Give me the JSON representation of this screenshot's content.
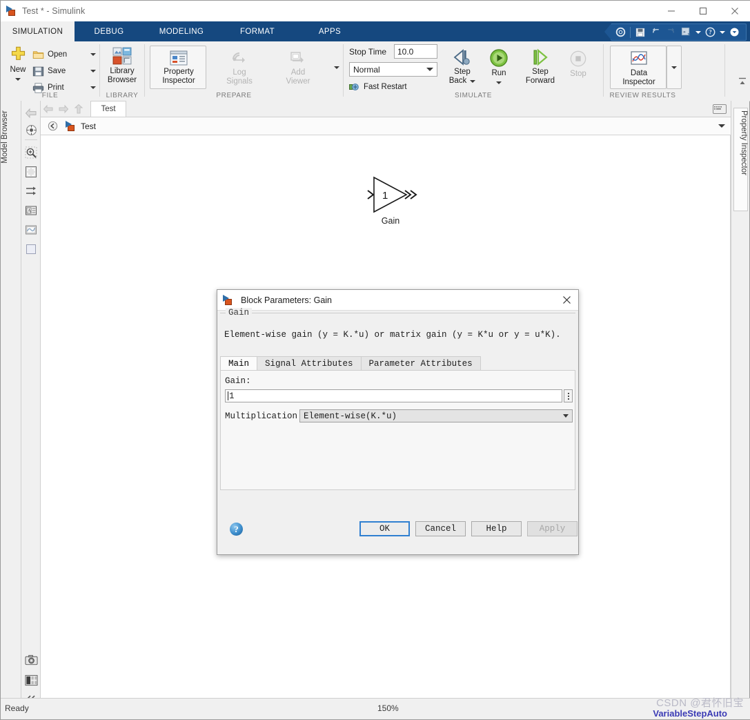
{
  "window": {
    "title": "Test * - Simulink",
    "app_icon": "simulink-icon",
    "minimize": "minimize-icon",
    "maximize": "maximize-icon",
    "close": "close-icon"
  },
  "ribbon_tabs": [
    {
      "label": "SIMULATION",
      "active": true
    },
    {
      "label": "DEBUG",
      "active": false
    },
    {
      "label": "MODELING",
      "active": false
    },
    {
      "label": "FORMAT",
      "active": false
    },
    {
      "label": "APPS",
      "active": false
    }
  ],
  "quick_access": [
    {
      "name": "settings-icon"
    },
    {
      "name": "save-icon"
    },
    {
      "name": "undo-icon"
    },
    {
      "name": "redo-icon"
    },
    {
      "name": "run-section-icon"
    },
    {
      "name": "help-icon"
    },
    {
      "name": "more-icon"
    }
  ],
  "ribbon": {
    "groups": [
      {
        "label": "FILE"
      },
      {
        "label": "LIBRARY"
      },
      {
        "label": "PREPARE"
      },
      {
        "label": "SIMULATE"
      },
      {
        "label": "REVIEW RESULTS"
      }
    ],
    "file": {
      "new_label": "New",
      "open_label": "Open",
      "save_label": "Save",
      "print_label": "Print"
    },
    "library": {
      "browser_line1": "Library",
      "browser_line2": "Browser"
    },
    "prepare": {
      "property_inspector_line1": "Property",
      "property_inspector_line2": "Inspector",
      "log_signals_line1": "Log",
      "log_signals_line2": "Signals",
      "add_viewer_line1": "Add",
      "add_viewer_line2": "Viewer"
    },
    "simulate": {
      "stop_time_label": "Stop Time",
      "stop_time_value": "10.0",
      "sim_mode_value": "Normal",
      "fast_restart_label": "Fast Restart",
      "step_back_line1": "Step",
      "step_back_line2": "Back",
      "run_label": "Run",
      "step_forward_line1": "Step",
      "step_forward_line2": "Forward",
      "stop_label": "Stop"
    },
    "review": {
      "data_inspector_line1": "Data",
      "data_inspector_line2": "Inspector"
    }
  },
  "left_panel": {
    "label": "Model  Browser"
  },
  "right_panel": {
    "label": "Property Inspector"
  },
  "tool_icons": [
    {
      "name": "pan-back-icon"
    },
    {
      "name": "navigate-icon"
    },
    {
      "name": "zoom-in-icon"
    },
    {
      "name": "fit-to-view-icon"
    },
    {
      "name": "signal-routing-icon"
    },
    {
      "name": "annotation-icon"
    },
    {
      "name": "scope-icon"
    },
    {
      "name": "subsystem-icon"
    },
    {
      "name": "camera-icon"
    },
    {
      "name": "layout-icon"
    },
    {
      "name": "collapse-icon"
    }
  ],
  "nav": {
    "back_icon": "back-arrow-icon",
    "forward_icon": "forward-arrow-icon",
    "up_icon": "up-arrow-icon",
    "model_tab_label": "Test",
    "keyboard_icon": "keyboard-icon"
  },
  "breadcrumb": {
    "back_icon": "breadcrumb-back-icon",
    "model_icon": "simulink-model-icon",
    "model_name": "Test",
    "expand_icon": "chevron-down-icon"
  },
  "canvas": {
    "blocks": [
      {
        "name": "Gain",
        "value": "1",
        "label": "Gain"
      }
    ]
  },
  "dialog": {
    "title": "Block Parameters: Gain",
    "icon": "simulink-icon",
    "close_icon": "close-icon",
    "group_legend": "Gain",
    "description": "Element-wise gain (y = K.*u) or matrix gain (y = K*u or y = u*K).",
    "tabs": [
      {
        "label": "Main",
        "active": true
      },
      {
        "label": "Signal Attributes",
        "active": false
      },
      {
        "label": "Parameter Attributes",
        "active": false
      }
    ],
    "fields": {
      "gain_label": "Gain:",
      "gain_value": "1",
      "gain_more_icon": "more-options-icon",
      "multiplication_label": "Multiplication:",
      "multiplication_value": "Element-wise(K.*u)"
    },
    "footer": {
      "help_orb": "?",
      "ok": "OK",
      "cancel": "Cancel",
      "help": "Help",
      "apply": "Apply"
    }
  },
  "status": {
    "ready": "Ready",
    "zoom": "150%"
  },
  "watermark": {
    "line1": "CSDN @君怀旧宝",
    "line2": "VariableStepAuto"
  },
  "colors": {
    "ribbon_blue": "#15487f",
    "quick_access_blue": "#1d5693",
    "accent_focus": "#2f7fd0",
    "chrome_gray": "#f0f0f0"
  }
}
